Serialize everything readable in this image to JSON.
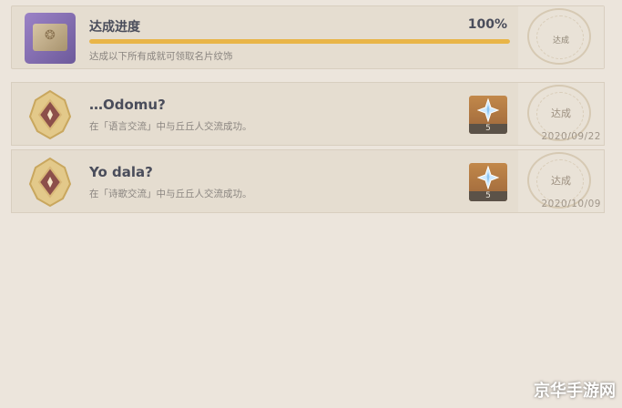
{
  "progress": {
    "title": "达成进度",
    "percent_label": "100%",
    "percent": 100,
    "description": "达成以下所有成就可领取名片纹饰",
    "stamp": "达成"
  },
  "achievements": [
    {
      "title": "…Odomu?",
      "description": "在「语言交流」中与丘丘人交流成功。",
      "reward_count": "5",
      "stamp": "达成",
      "date": "2020/09/22"
    },
    {
      "title": "Yo dala?",
      "description": "在「诗歌交流」中与丘丘人交流成功。",
      "reward_count": "5",
      "stamp": "达成",
      "date": "2020/10/09"
    }
  ],
  "watermark": "京华手游网",
  "colors": {
    "accent_bar": "#e9b548",
    "background": "#ece5dc",
    "panel": "#e5ddd0"
  },
  "icons": {
    "book": "namecard-book-icon",
    "medal": "achievement-medal-icon",
    "reward": "primogem-icon"
  }
}
